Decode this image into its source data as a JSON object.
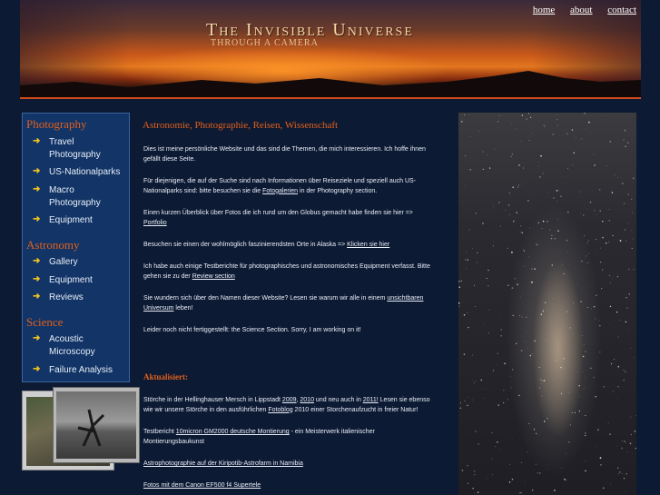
{
  "header": {
    "title": "The Invisible Universe",
    "subtitle": "Through a camera",
    "nav": [
      "home",
      "about",
      "contact"
    ]
  },
  "sidebar": {
    "sections": [
      {
        "title": "Photography",
        "items": [
          "Travel Photography",
          "US-Nationalparks",
          "Macro Photography",
          "Equipment"
        ]
      },
      {
        "title": "Astronomy",
        "items": [
          "Gallery",
          "Equipment",
          "Reviews"
        ]
      },
      {
        "title": "Science",
        "items": [
          "Acoustic Microscopy",
          "Failure Analysis"
        ]
      }
    ]
  },
  "main": {
    "title": "Astronomie, Photographie, Reisen, Wissenschaft",
    "p1": "Dies ist meine persönliche Website und das sind die Themen, die mich interessieren. Ich hoffe ihnen gefällt diese Seite.",
    "p2_pre": "Für diejenigen, die auf der Suche sind nach Informationen über Reiseziele und speziell auch US-Nationalparks sind: bitte besuchen sie die ",
    "p2_link": "Fotogalerien",
    "p2_post": " in der Photography section.",
    "p3_pre": "Einen kurzen Überblick über Fotos die ich rund um den Globus gemacht habe finden sie hier => ",
    "p3_link": "Portfolio",
    "p4_pre": "Besuchen sie einen der wohlmöglich faszinierendsten Orte in Alaska => ",
    "p4_link": "Klicken sie hier",
    "p5_pre": "Ich habe auch einige Testberichte für photographisches und astronomisches Equipment verfasst. Bitte gehen sie zu der ",
    "p5_link": "Review section",
    "p6_pre": "Sie wundern sich über den Namen dieser Website? Lesen sie warum wir alle in einem ",
    "p6_link": "unsichtbaren Universum",
    "p6_post": " leben!",
    "p7": "Leider noch nicht fertiggestellt: the Science Section. Sorry, I am working on it!",
    "update_title": "Aktualisiert:",
    "u1_pre": "Störche in der Hellinghauser Mersch in Lippstadt ",
    "u1_link1": "2009",
    "u1_mid1": ", ",
    "u1_link2": "2010",
    "u1_mid2": " und neu auch in ",
    "u1_link3": "2011!",
    "u1_mid3": " Lesen sie ebenso wie wir unsere Störche in den ausführlichen ",
    "u1_link4": "Fotoblog",
    "u1_post": " 2010 einer Storchenaufzucht in freier Natur!",
    "u2_pre": "Testbericht ",
    "u2_link": "10micron GM2000 deutsche Montierung",
    "u2_post": " - ein Meisterwerk italienischer Montierungsbaukunst",
    "u3_link": "Astrophotographie auf der Kiripotib-Astrofarm in Namibia",
    "u4_link": "Fotos mit dem Canon EF500 f4 Supertele"
  },
  "colors": {
    "accent": "#e0601c",
    "panel": "#123466",
    "background": "#0d1a33",
    "arrow": "#f0c020"
  }
}
